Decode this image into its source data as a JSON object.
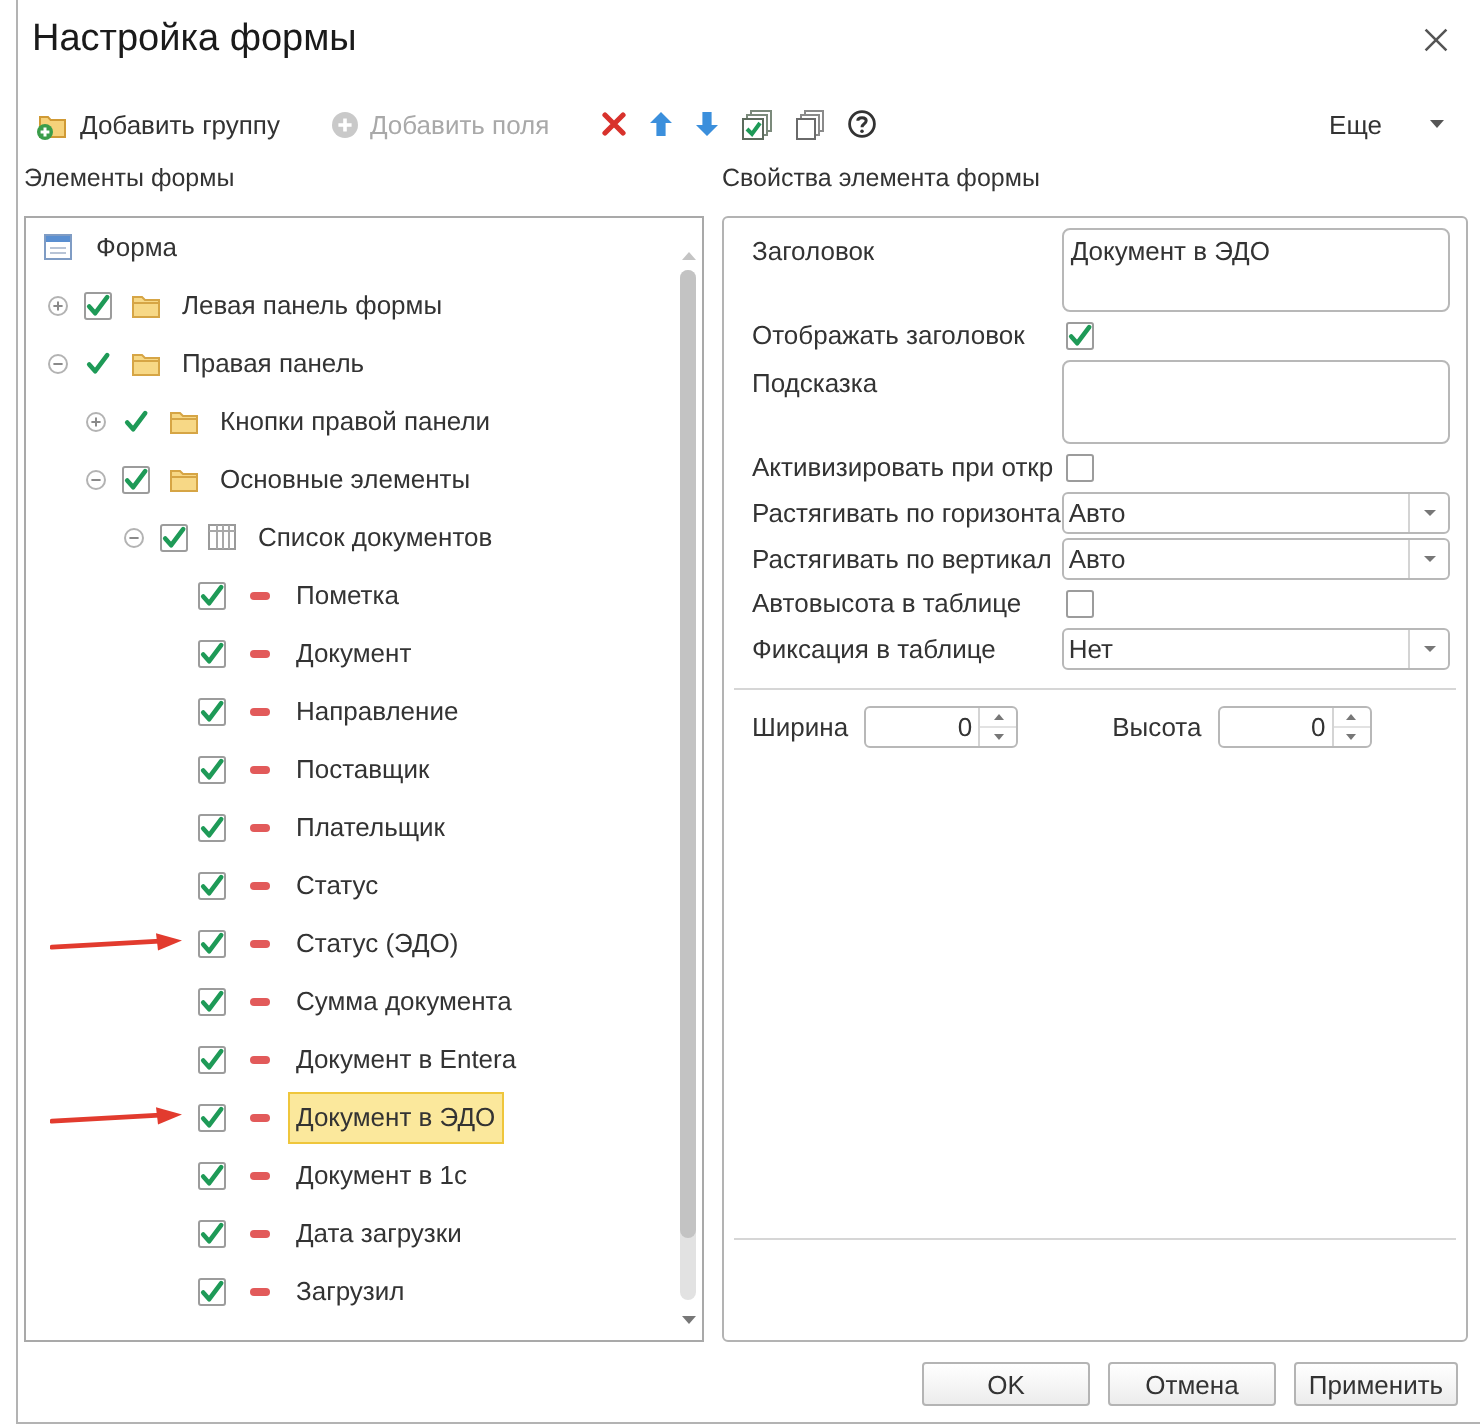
{
  "window": {
    "title": "Настройка формы"
  },
  "toolbar": {
    "buttons": [
      {
        "label": "Добавить группу",
        "disabled": false
      },
      {
        "label": "Добавить поля",
        "disabled": true
      }
    ],
    "more": {
      "label": "Еще"
    }
  },
  "panels": {
    "left_title": "Элементы формы",
    "right_title": "Свойства элемента формы"
  },
  "tree": {
    "items": [
      {
        "kind": "form",
        "label": "Форма",
        "selected": false,
        "children": [
          {
            "kind": "group",
            "label": "Левая панель формы",
            "checked": true,
            "framed": true,
            "expanded": false,
            "selected": false
          },
          {
            "kind": "group",
            "label": "Правая панель",
            "checked": true,
            "framed": false,
            "expanded": true,
            "selected": false,
            "children": [
              {
                "kind": "group",
                "label": "Кнопки правой панели",
                "checked": true,
                "framed": false,
                "expanded": false,
                "selected": false
              },
              {
                "kind": "group",
                "label": "Основные элементы",
                "checked": true,
                "framed": true,
                "expanded": true,
                "selected": false,
                "children": [
                  {
                    "kind": "table",
                    "label": "Список документов",
                    "checked": true,
                    "framed": true,
                    "expanded": true,
                    "selected": false,
                    "children": [
                      {
                        "kind": "field",
                        "label": "Пометка",
                        "checked": true,
                        "framed": true,
                        "selected": false,
                        "arrow": false
                      },
                      {
                        "kind": "field",
                        "label": "Документ",
                        "checked": true,
                        "framed": true,
                        "selected": false,
                        "arrow": false
                      },
                      {
                        "kind": "field",
                        "label": "Направление",
                        "checked": true,
                        "framed": true,
                        "selected": false,
                        "arrow": false
                      },
                      {
                        "kind": "field",
                        "label": "Поставщик",
                        "checked": true,
                        "framed": true,
                        "selected": false,
                        "arrow": false
                      },
                      {
                        "kind": "field",
                        "label": "Плательщик",
                        "checked": true,
                        "framed": true,
                        "selected": false,
                        "arrow": false
                      },
                      {
                        "kind": "field",
                        "label": "Статус",
                        "checked": true,
                        "framed": true,
                        "selected": false,
                        "arrow": false
                      },
                      {
                        "kind": "field",
                        "label": "Статус (ЭДО)",
                        "checked": true,
                        "framed": true,
                        "selected": false,
                        "arrow": true
                      },
                      {
                        "kind": "field",
                        "label": "Сумма документа",
                        "checked": true,
                        "framed": true,
                        "selected": false,
                        "arrow": false
                      },
                      {
                        "kind": "field",
                        "label": "Документ в Entera",
                        "checked": true,
                        "framed": true,
                        "selected": false,
                        "arrow": false
                      },
                      {
                        "kind": "field",
                        "label": "Документ в ЭДО",
                        "checked": true,
                        "framed": true,
                        "selected": true,
                        "arrow": true
                      },
                      {
                        "kind": "field",
                        "label": "Документ в 1с",
                        "checked": true,
                        "framed": true,
                        "selected": false,
                        "arrow": false
                      },
                      {
                        "kind": "field",
                        "label": "Дата загрузки",
                        "checked": true,
                        "framed": true,
                        "selected": false,
                        "arrow": false
                      },
                      {
                        "kind": "field",
                        "label": "Загрузил",
                        "checked": true,
                        "framed": true,
                        "selected": false,
                        "arrow": false
                      }
                    ]
                  }
                ]
              }
            ]
          }
        ]
      }
    ]
  },
  "properties": {
    "rows": [
      {
        "kind": "textarea",
        "label": "Заголовок",
        "value": "Документ в ЭДО"
      },
      {
        "kind": "checkbox",
        "label": "Отображать заголовок",
        "checked": true
      },
      {
        "kind": "textarea",
        "label": "Подсказка"
      },
      {
        "kind": "checkbox",
        "label": "Активизировать при откр",
        "checked": false
      },
      {
        "kind": "select",
        "label": "Растягивать по горизонта",
        "value": "Авто"
      },
      {
        "kind": "select",
        "label": "Растягивать по вертикал",
        "value": "Авто"
      },
      {
        "kind": "checkbox",
        "label": "Автовысота в таблице",
        "checked": false
      },
      {
        "kind": "select",
        "label": "Фиксация в таблице",
        "value": "Нет"
      }
    ],
    "sizes": [
      {
        "label": "Ширина",
        "value": "0"
      },
      {
        "label": "Высота",
        "value": "0"
      }
    ]
  },
  "buttons": [
    {
      "label": "OK"
    },
    {
      "label": "Отмена"
    },
    {
      "label": "Применить"
    }
  ]
}
